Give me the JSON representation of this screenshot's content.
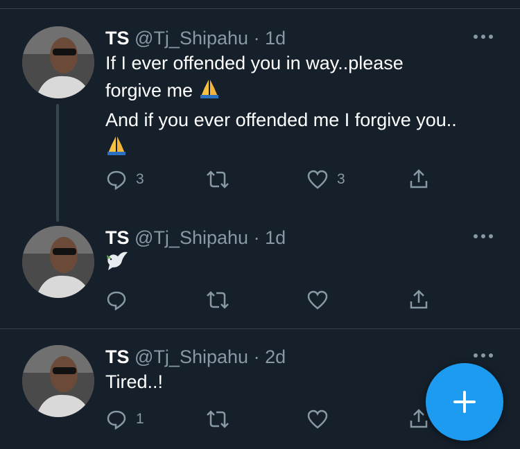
{
  "tweets": [
    {
      "name": "TS",
      "handle": "@Tj_Shipahu",
      "separator": "·",
      "time": "1d",
      "text_line1": "If I ever offended you in way..please",
      "text_line2": "forgive me",
      "text_line3": "And if you ever offended me I forgive you..",
      "reply_count": "3",
      "retweet_count": "",
      "like_count": "3"
    },
    {
      "name": "TS",
      "handle": "@Tj_Shipahu",
      "separator": "·",
      "time": "1d",
      "reply_count": "",
      "retweet_count": "",
      "like_count": ""
    },
    {
      "name": "TS",
      "handle": "@Tj_Shipahu",
      "separator": "·",
      "time": "2d",
      "text_line1": "Tired..!",
      "reply_count": "1",
      "retweet_count": "",
      "like_count": ""
    }
  ],
  "icons": {
    "reply": "reply-icon",
    "retweet": "retweet-icon",
    "like": "heart-icon",
    "share": "share-icon",
    "more": "more-icon",
    "compose": "plus-icon",
    "prayer": "folded-hands-emoji",
    "dove": "dove-emoji"
  },
  "colors": {
    "background": "#15202b",
    "divider": "#38444d",
    "muted": "#8899a6",
    "accent": "#1d9bf0",
    "text": "#ffffff"
  }
}
